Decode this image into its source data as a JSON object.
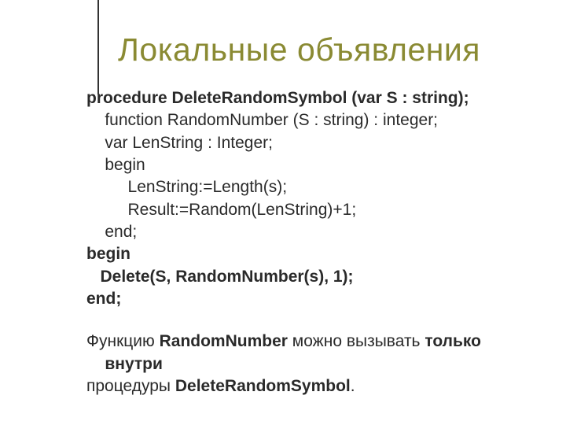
{
  "title": "Локальные объявления",
  "code": {
    "l1a": "procedure",
    "l1b": " DeleteRandomSymbol (var S : string);",
    "l2": "    function RandomNumber (S : string) : integer;",
    "l3": "    var LenString : Integer;",
    "l4": "    begin",
    "l5": "         LenString:=Length(s);",
    "l6": "         Result:=Random(LenString)+1;",
    "l7": "    end;",
    "l8": "begin",
    "l9": "   Delete(S, RandomNumber(s), 1);",
    "l10": "end;"
  },
  "note": {
    "p1a": "Функцию ",
    "p1b": "RandomNumber",
    "p1c": " можно вызывать ",
    "p1d": "только",
    "p2_indent": "    ",
    "p2": "внутри",
    "p3a": "процедуры ",
    "p3b": "DeleteRandomSymbol",
    "p3c": "."
  }
}
